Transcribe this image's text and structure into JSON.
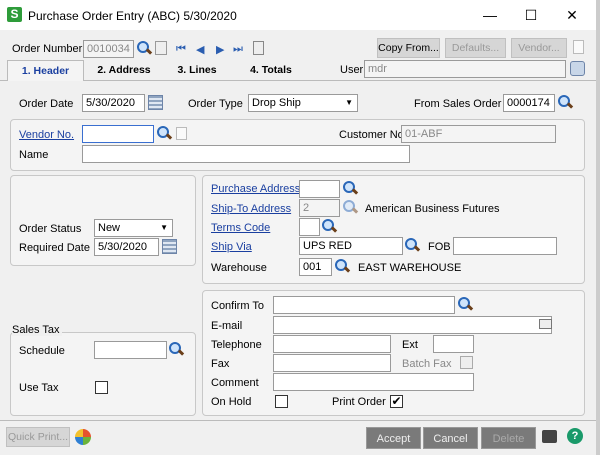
{
  "window": {
    "title": "Purchase Order Entry (ABC) 5/30/2020",
    "logo": "S",
    "minimize": "—",
    "maximize": "☐",
    "close": "✕"
  },
  "toolbar": {
    "order_number_label": "Order Number",
    "order_number": "0010034",
    "copy_from": "Copy From...",
    "defaults": "Defaults...",
    "vendor": "Vendor...",
    "user_label": "User",
    "user": "mdr"
  },
  "tabs": [
    {
      "label": "1. Header",
      "active": true
    },
    {
      "label": "2. Address"
    },
    {
      "label": "3. Lines"
    },
    {
      "label": "4. Totals"
    }
  ],
  "header": {
    "order_date_label": "Order Date",
    "order_date": "5/30/2020",
    "order_type_label": "Order Type",
    "order_type": "Drop Ship",
    "from_so_label": "From Sales Order",
    "from_so": "0000174"
  },
  "vendor": {
    "vendor_no_label": "Vendor No.",
    "vendor_no": "",
    "customer_no_label": "Customer No.",
    "customer_no": "01-ABF",
    "name_label": "Name",
    "name": ""
  },
  "status": {
    "order_status_label": "Order Status",
    "order_status": "New",
    "required_date_label": "Required Date",
    "required_date": "5/30/2020"
  },
  "shipping": {
    "purchase_address_label": "Purchase Address",
    "purchase_address": "",
    "ship_to_label": "Ship-To Address",
    "ship_to": "2",
    "ship_to_name": "American Business Futures",
    "terms_label": "Terms Code",
    "terms": "",
    "ship_via_label": "Ship Via",
    "ship_via": "UPS RED",
    "fob_label": "FOB",
    "fob": "",
    "warehouse_label": "Warehouse",
    "warehouse": "001",
    "warehouse_name": "EAST WAREHOUSE"
  },
  "contact": {
    "confirm_to_label": "Confirm To",
    "email_label": "E-mail",
    "telephone_label": "Telephone",
    "ext_label": "Ext",
    "fax_label": "Fax",
    "batch_fax_label": "Batch Fax",
    "comment_label": "Comment",
    "on_hold_label": "On Hold",
    "on_hold": false,
    "print_order_label": "Print Order",
    "print_order": true,
    "print_order_mark": "✔"
  },
  "tax": {
    "section_label": "Sales Tax",
    "schedule_label": "Schedule",
    "schedule": "",
    "use_tax_label": "Use Tax",
    "use_tax": false
  },
  "footer": {
    "quick_print": "Quick Print...",
    "accept": "Accept",
    "cancel": "Cancel",
    "delete": "Delete",
    "help": "?"
  },
  "colors": {
    "accent": "#1a3fa0",
    "logo": "#2e9c3a",
    "action_button": "#7a7a7a"
  }
}
